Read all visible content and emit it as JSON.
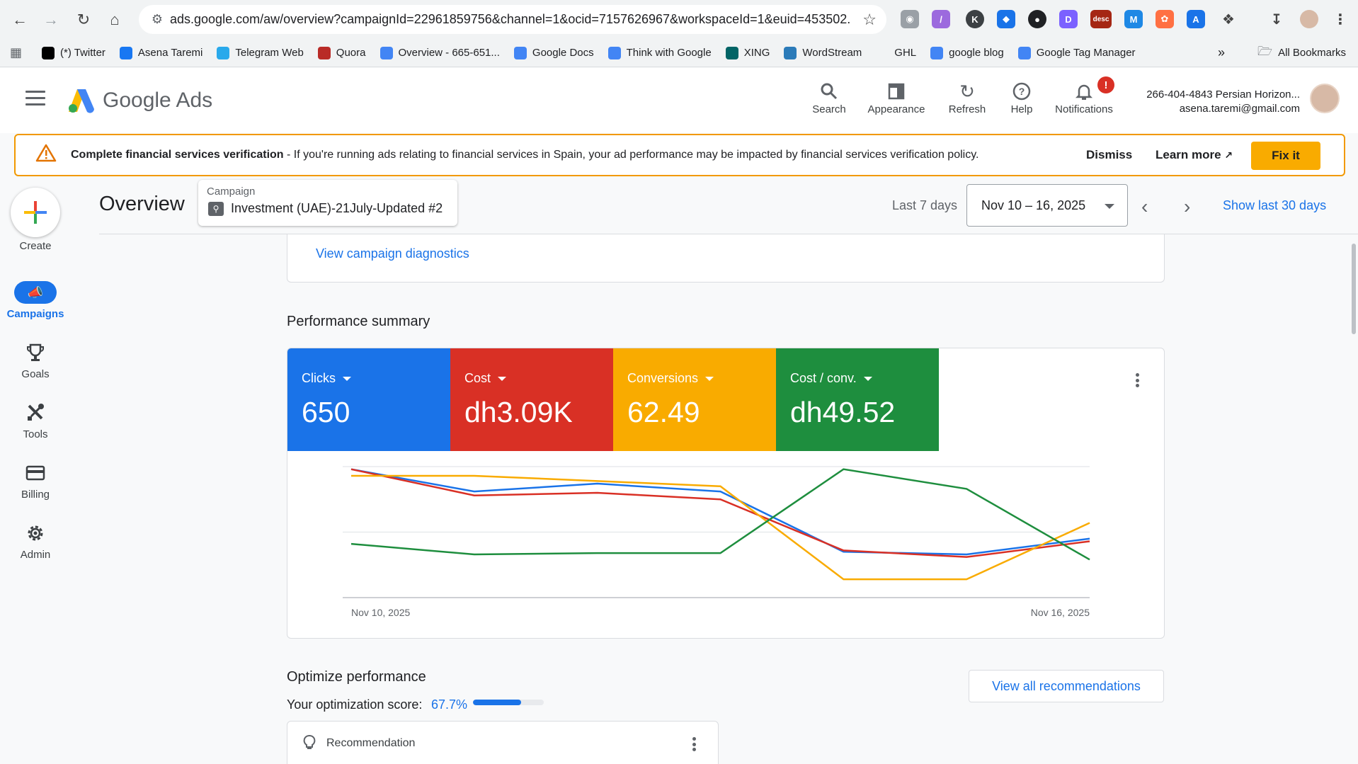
{
  "browser": {
    "url": "ads.google.com/aw/overview?campaignId=22961859756&channel=1&ocid=7157626967&workspaceId=1&euid=453502...",
    "bookmarks": [
      {
        "label": "(*) Twitter",
        "icon": "x-icon",
        "color": "#000000"
      },
      {
        "label": "Asena Taremi",
        "icon": "facebook-icon",
        "color": "#1877f2"
      },
      {
        "label": "Telegram Web",
        "icon": "telegram-icon",
        "color": "#29a9eb"
      },
      {
        "label": "Quora",
        "icon": "quora-icon",
        "color": "#b92b27"
      },
      {
        "label": "Overview - 665-651...",
        "icon": "google-icon",
        "color": "#4285f4"
      },
      {
        "label": "Google Docs",
        "icon": "docs-icon",
        "color": "#4285f4"
      },
      {
        "label": "Think with Google",
        "icon": "google-icon",
        "color": "#4285f4"
      },
      {
        "label": "XING",
        "icon": "xing-icon",
        "color": "#026466"
      },
      {
        "label": "WordStream",
        "icon": "wordstream-icon",
        "color": "#2b7bb9"
      },
      {
        "label": "GHL",
        "icon": "ghl-icon",
        "color": "#f1f3f4"
      },
      {
        "label": "google blog",
        "icon": "google-icon",
        "color": "#4285f4"
      },
      {
        "label": "Google Tag Manager",
        "icon": "gtm-icon",
        "color": "#4285f4"
      }
    ],
    "more_label": "»",
    "all_bookmarks_label": "All Bookmarks",
    "ext_desc_label": "desc"
  },
  "header": {
    "product_google": "Google",
    "product_ads": "Ads",
    "actions": [
      {
        "label": "Search",
        "icon": "search-icon"
      },
      {
        "label": "Appearance",
        "icon": "appearance-icon"
      },
      {
        "label": "Refresh",
        "icon": "refresh-icon"
      },
      {
        "label": "Help",
        "icon": "help-icon"
      },
      {
        "label": "Notifications",
        "icon": "bell-icon"
      }
    ],
    "notification_badge": "!",
    "account_name": "266-404-4843 Persian Horizon...",
    "account_email": "asena.taremi@gmail.com"
  },
  "banner": {
    "title": "Complete financial services verification",
    "message": " - If you're running ads relating to financial services in Spain, your ad performance may be impacted by financial services verification policy.",
    "dismiss": "Dismiss",
    "learn_more": "Learn more",
    "fix_it": "Fix it"
  },
  "nav": {
    "create": "Create",
    "items": [
      {
        "label": "Campaigns",
        "icon": "campaigns-icon",
        "active": true
      },
      {
        "label": "Goals",
        "icon": "trophy-icon",
        "active": false
      },
      {
        "label": "Tools",
        "icon": "tools-icon",
        "active": false
      },
      {
        "label": "Billing",
        "icon": "billing-icon",
        "active": false
      },
      {
        "label": "Admin",
        "icon": "gear-icon",
        "active": false
      }
    ]
  },
  "page": {
    "title": "Overview",
    "campaign_label": "Campaign",
    "campaign_name": "Investment (UAE)-21July-Updated #2",
    "period_label": "Last 7 days",
    "date_range": "Nov 10 – 16, 2025",
    "show_last_30": "Show last 30 days",
    "diagnostics_link": "View campaign diagnostics"
  },
  "performance": {
    "title": "Performance summary",
    "metrics": [
      {
        "label": "Clicks",
        "value": "650",
        "color": "#1a73e8"
      },
      {
        "label": "Cost",
        "value": "dh3.09K",
        "color": "#d93025"
      },
      {
        "label": "Conversions",
        "value": "62.49",
        "color": "#f9ab00"
      },
      {
        "label": "Cost / conv.",
        "value": "dh49.52",
        "color": "#1e8e3e"
      }
    ]
  },
  "chart_data": {
    "type": "line",
    "x": [
      "Nov 10, 2025",
      "Nov 11, 2025",
      "Nov 12, 2025",
      "Nov 13, 2025",
      "Nov 14, 2025",
      "Nov 15, 2025",
      "Nov 16, 2025"
    ],
    "x_tick_labels": [
      "Nov 10, 2025",
      "Nov 16, 2025"
    ],
    "ylim": [
      0,
      1
    ],
    "grid": true,
    "series": [
      {
        "metric": "Clicks",
        "color": "#1a73e8",
        "values": [
          0.98,
          0.81,
          0.87,
          0.81,
          0.35,
          0.33,
          0.45
        ]
      },
      {
        "metric": "Cost",
        "color": "#d93025",
        "values": [
          0.98,
          0.78,
          0.8,
          0.75,
          0.36,
          0.31,
          0.43
        ]
      },
      {
        "metric": "Conversions",
        "color": "#f9ab00",
        "values": [
          0.93,
          0.93,
          0.89,
          0.85,
          0.14,
          0.14,
          0.57
        ]
      },
      {
        "metric": "Cost / conv.",
        "color": "#1e8e3e",
        "values": [
          0.41,
          0.33,
          0.34,
          0.34,
          0.98,
          0.83,
          0.29
        ]
      }
    ]
  },
  "optimize": {
    "title": "Optimize performance",
    "score_label": "Your optimization score:",
    "score_value": "67.7%",
    "score_fraction": 0.677,
    "view_all": "View all recommendations",
    "recommendation_label": "Recommendation"
  }
}
